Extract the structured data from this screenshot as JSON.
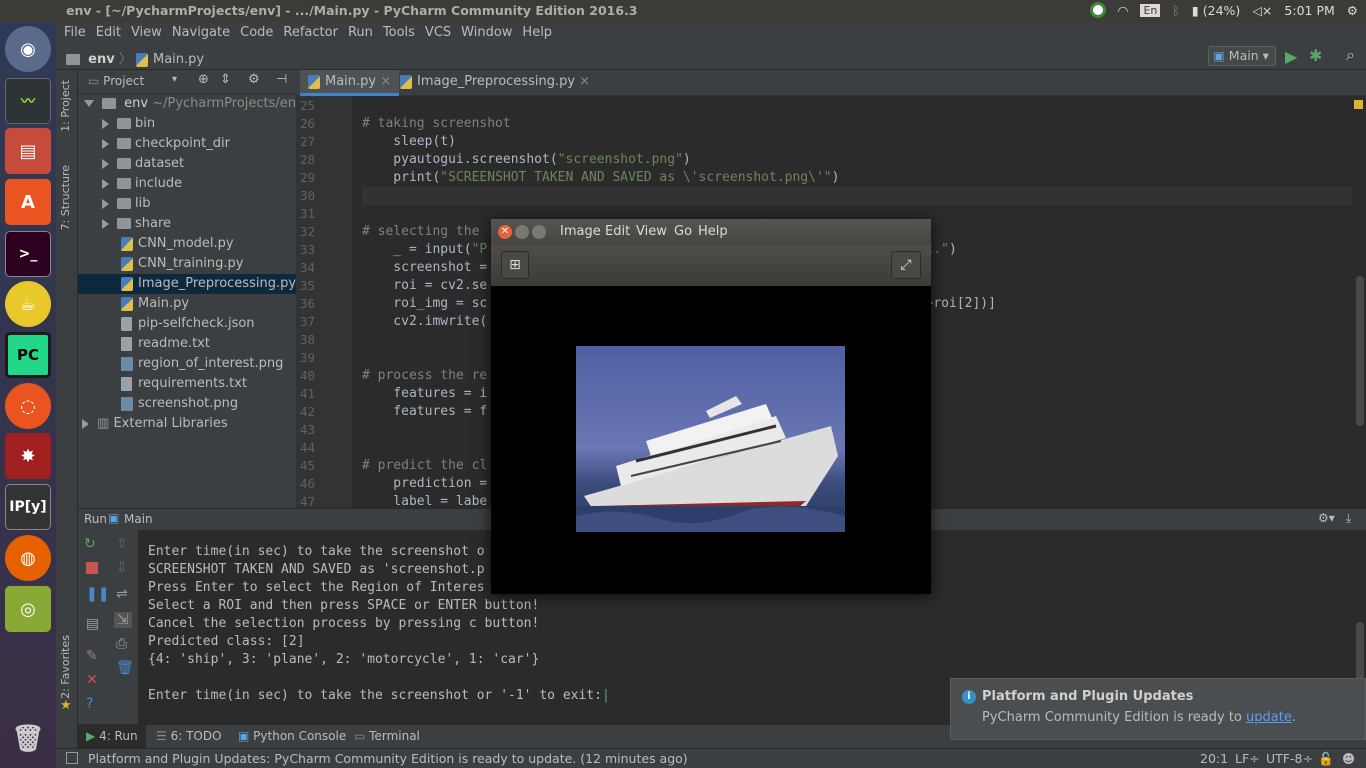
{
  "topbar": {
    "title": "env - [~/PycharmProjects/env] - .../Main.py - PyCharm Community Edition 2016.3",
    "lang": "En",
    "battery": "(24%)",
    "time": "5:01 PM"
  },
  "menu": [
    "File",
    "Edit",
    "View",
    "Navigate",
    "Code",
    "Refactor",
    "Run",
    "Tools",
    "VCS",
    "Window",
    "Help"
  ],
  "breadcrumb": {
    "project": "env",
    "file": "Main.py"
  },
  "run_config": "Main",
  "left_tool_tabs": {
    "project": "1: Project",
    "structure": "7: Structure",
    "favorites": "2: Favorites"
  },
  "project_panel": {
    "header": "Project",
    "root_name": "env",
    "root_path": "~/PycharmProjects/env",
    "folders": [
      "bin",
      "checkpoint_dir",
      "dataset",
      "include",
      "lib",
      "share"
    ],
    "files": [
      {
        "name": "CNN_model.py",
        "kind": "py"
      },
      {
        "name": "CNN_training.py",
        "kind": "py"
      },
      {
        "name": "Image_Preprocessing.py",
        "kind": "py",
        "selected": true
      },
      {
        "name": "Main.py",
        "kind": "py"
      },
      {
        "name": "pip-selfcheck.json",
        "kind": "txt"
      },
      {
        "name": "readme.txt",
        "kind": "txt"
      },
      {
        "name": "region_of_interest.png",
        "kind": "img"
      },
      {
        "name": "requirements.txt",
        "kind": "txt"
      },
      {
        "name": "screenshot.png",
        "kind": "img"
      }
    ],
    "external": "External Libraries"
  },
  "editor_tabs": [
    "Main.py",
    "Image_Preprocessing.py"
  ],
  "code_lines": [
    {
      "n": "25",
      "t": ""
    },
    {
      "n": "26",
      "t": "# taking screenshot",
      "c": "cm"
    },
    {
      "n": "27",
      "t": "    sleep(t)"
    },
    {
      "n": "28",
      "t": "    pyautogui.screenshot(\"screenshot.png\")"
    },
    {
      "n": "29",
      "t": "    print(\"SCREENSHOT TAKEN AND SAVED as \\'screenshot.png\\'\")"
    },
    {
      "n": "30",
      "t": "",
      "hl": true
    },
    {
      "n": "31",
      "t": ""
    },
    {
      "n": "32",
      "t": "# selecting the",
      "c": "cm"
    },
    {
      "n": "33",
      "t": "    _ = input(\"P                                                 reenshot.\")"
    },
    {
      "n": "34",
      "t": "    screenshot ="
    },
    {
      "n": "35",
      "t": "    roi = cv2.se"
    },
    {
      "n": "36",
      "t": "    roi_img = sc                                              int(roi[0]+roi[2])]"
    },
    {
      "n": "37",
      "t": "    cv2.imwrite("
    },
    {
      "n": "38",
      "t": ""
    },
    {
      "n": "39",
      "t": ""
    },
    {
      "n": "40",
      "t": "# process the re",
      "c": "cm"
    },
    {
      "n": "41",
      "t": "    features = i"
    },
    {
      "n": "42",
      "t": "    features = f"
    },
    {
      "n": "43",
      "t": ""
    },
    {
      "n": "44",
      "t": ""
    },
    {
      "n": "45",
      "t": "# predict the cl",
      "c": "cm"
    },
    {
      "n": "46",
      "t": "    prediction ="
    },
    {
      "n": "47",
      "t": "    label = labe"
    }
  ],
  "run_panel": {
    "label": "Run",
    "config": "Main"
  },
  "console_lines": [
    "Enter time(in sec) to take the screenshot o",
    "SCREENSHOT TAKEN AND SAVED as 'screenshot.p",
    "Press Enter to select the Region of Interes",
    "Select a ROI and then press SPACE or ENTER button!",
    "Cancel the selection process by pressing c button!",
    "Predicted class: [2]",
    "{4: 'ship', 3: 'plane', 2: 'motorcycle', 1: 'car'}",
    "",
    "Enter time(in sec) to take the screenshot or '-1' to exit:"
  ],
  "bottom_tabs": [
    "4: Run",
    "6: TODO",
    "Python Console",
    "Terminal"
  ],
  "status": {
    "message": "Platform and Plugin Updates: PyCharm Community Edition is ready to update. (12 minutes ago)",
    "position": "20:1",
    "line_sep": "LF÷",
    "encoding": "UTF-8÷"
  },
  "image_window": {
    "menu": [
      "Image",
      "Edit",
      "View",
      "Go",
      "Help"
    ]
  },
  "notification": {
    "title": "Platform and Plugin Updates",
    "body": "PyCharm Community Edition is ready to",
    "link": "update"
  }
}
